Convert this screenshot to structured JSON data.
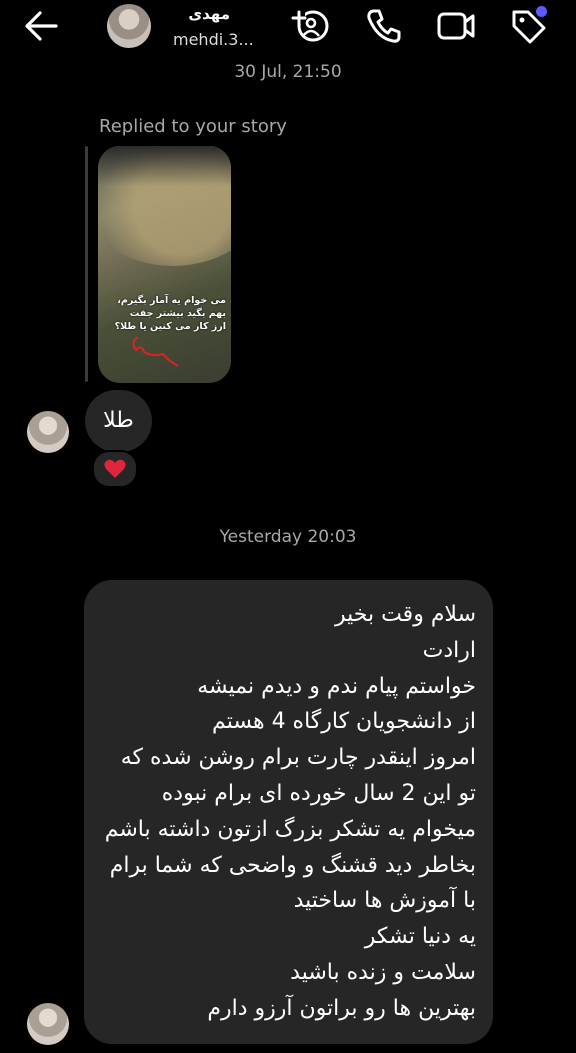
{
  "header": {
    "name": "مهدی",
    "username": "mehdi.3..."
  },
  "timestamps": {
    "top": "30 Jul, 21:50",
    "middle": "Yesterday 20:03"
  },
  "reply": {
    "label": "Replied to your story",
    "story_text": "می خوام یه آمار بگیرم، بهم بگید بیشتر جفت ارز کار می کنین یا طلا؟"
  },
  "message_gold": {
    "text": "طلا",
    "reaction": "heart"
  },
  "long_message": {
    "lines": [
      "سلام وقت بخیر",
      "ارادت",
      "خواستم پیام ندم و دیدم نمیشه",
      "از دانشجویان کارگاه 4 هستم",
      "امروز اینقدر چارت برام روشن شده که",
      "تو این 2 سال خورده ای برام نبوده",
      "میخوام یه تشکر بزرگ ازتون داشته باشم",
      "بخاطر دید قشنگ و واضحی که شما برام",
      "با آموزش ها ساختید",
      "یه دنیا تشکر",
      "سلامت و زنده باشید",
      "بهترین ها رو براتون آرزو دارم"
    ]
  },
  "colors": {
    "background": "#000000",
    "bubble": "#262626",
    "muted_text": "#a8a8a8",
    "badge": "#5b5bff",
    "heart": "#e0263a"
  },
  "icons": [
    "back-arrow-icon",
    "add-user-icon",
    "phone-icon",
    "video-icon",
    "tag-icon",
    "heart-icon"
  ]
}
